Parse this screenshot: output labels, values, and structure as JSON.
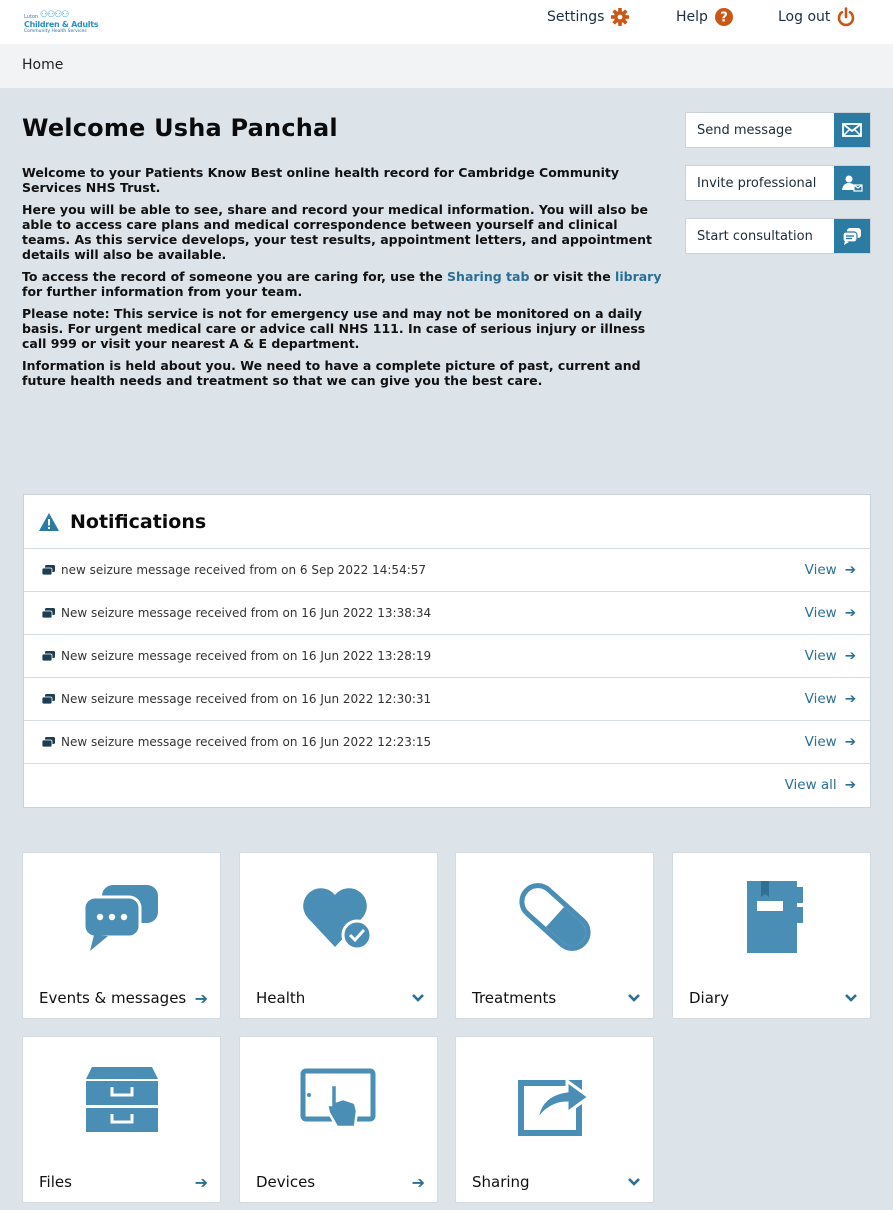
{
  "logo": {
    "line1": "Luton",
    "line2": "Children & Adults",
    "line3": "Community Health Services"
  },
  "topnav": {
    "settings": "Settings",
    "help": "Help",
    "logout": "Log out"
  },
  "breadcrumb": {
    "home": "Home"
  },
  "welcome": {
    "title": "Welcome Usha Panchal",
    "p1": "Welcome to your Patients Know Best online health record for Cambridge Community Services NHS Trust.",
    "p2": "Here you will be able to see, share and record your medical information. You will also be able to access care plans and medical correspondence between yourself and clinical teams. As this service develops, your test results, appointment letters, and appointment details will also be available.",
    "p3_a": "To access the record of someone you are caring for, use the ",
    "p3_link1": "Sharing tab",
    "p3_b": " or visit the ",
    "p3_link2": "library",
    "p3_c": " for further information from your team.",
    "p4": "Please note: This service is not for emergency use and may not be monitored on a daily basis. For urgent medical care or advice call NHS 111. In case of serious injury or illness call 999 or visit your nearest A & E department.",
    "p5": "Information is held about you. We need to have a complete picture of past, current and future health needs and treatment so that we can give you the best care."
  },
  "actions": {
    "send_message": "Send message",
    "invite_professional": "Invite professional",
    "start_consultation": "Start consultation"
  },
  "notifications": {
    "title": "Notifications",
    "items": [
      {
        "text": "new seizure message received from on 6 Sep 2022 14:54:57",
        "view": "View"
      },
      {
        "text": "New seizure message received from on 16 Jun 2022 13:38:34",
        "view": "View"
      },
      {
        "text": "New seizure message received from on 16 Jun 2022 13:28:19",
        "view": "View"
      },
      {
        "text": "New seizure message received from on 16 Jun 2022 12:30:31",
        "view": "View"
      },
      {
        "text": "New seizure message received from on 16 Jun 2022 12:23:15",
        "view": "View"
      }
    ],
    "view_all": "View all"
  },
  "tiles": {
    "events": "Events & messages",
    "health": "Health",
    "treatments": "Treatments",
    "diary": "Diary",
    "files": "Files",
    "devices": "Devices",
    "sharing": "Sharing"
  },
  "colors": {
    "accent": "#2c7ba3",
    "icon_blue": "#4a8db5",
    "orange": "#c95817",
    "background": "#dce3e9"
  }
}
